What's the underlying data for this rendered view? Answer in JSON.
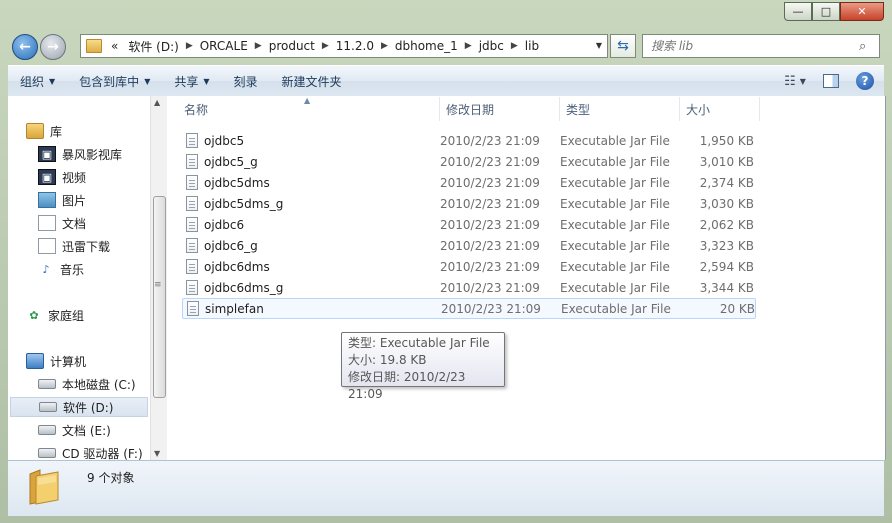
{
  "window": {
    "caption": {
      "minimize": "—",
      "maximize": "□",
      "close": "✕"
    }
  },
  "address": {
    "prefix": "«",
    "crumbs": [
      "软件 (D:)",
      "ORCALE",
      "product",
      "11.2.0",
      "dbhome_1",
      "jdbc",
      "lib"
    ]
  },
  "search": {
    "placeholder": "搜索 lib"
  },
  "toolbar": {
    "organize": "组织",
    "include_in_library": "包含到库中",
    "share": "共享",
    "burn": "刻录",
    "new_folder": "新建文件夹",
    "help": "?"
  },
  "nav_pane": {
    "items": [
      {
        "label": "库",
        "icon": "library-icon"
      },
      {
        "label": "暴风影视库",
        "icon": "video-library-icon"
      },
      {
        "label": "视频",
        "icon": "video-icon"
      },
      {
        "label": "图片",
        "icon": "pictures-icon"
      },
      {
        "label": "文档",
        "icon": "documents-icon"
      },
      {
        "label": "迅雷下载",
        "icon": "documents-icon"
      },
      {
        "label": "音乐",
        "icon": "music-icon"
      },
      {
        "label": "家庭组",
        "icon": "homegroup-icon"
      },
      {
        "label": "计算机",
        "icon": "computer-icon"
      },
      {
        "label": "本地磁盘 (C:)",
        "icon": "drive-icon"
      },
      {
        "label": "软件 (D:)",
        "icon": "drive-icon"
      },
      {
        "label": "文档 (E:)",
        "icon": "drive-icon"
      },
      {
        "label": "CD 驱动器 (F:)",
        "icon": "cd-drive-icon"
      }
    ]
  },
  "columns": {
    "name": "名称",
    "modified": "修改日期",
    "type": "类型",
    "size": "大小"
  },
  "files": [
    {
      "name": "ojdbc5",
      "modified": "2010/2/23 21:09",
      "type": "Executable Jar File",
      "size": "1,950 KB"
    },
    {
      "name": "ojdbc5_g",
      "modified": "2010/2/23 21:09",
      "type": "Executable Jar File",
      "size": "3,010 KB"
    },
    {
      "name": "ojdbc5dms",
      "modified": "2010/2/23 21:09",
      "type": "Executable Jar File",
      "size": "2,374 KB"
    },
    {
      "name": "ojdbc5dms_g",
      "modified": "2010/2/23 21:09",
      "type": "Executable Jar File",
      "size": "3,030 KB"
    },
    {
      "name": "ojdbc6",
      "modified": "2010/2/23 21:09",
      "type": "Executable Jar File",
      "size": "2,062 KB"
    },
    {
      "name": "ojdbc6_g",
      "modified": "2010/2/23 21:09",
      "type": "Executable Jar File",
      "size": "3,323 KB"
    },
    {
      "name": "ojdbc6dms",
      "modified": "2010/2/23 21:09",
      "type": "Executable Jar File",
      "size": "2,594 KB"
    },
    {
      "name": "ojdbc6dms_g",
      "modified": "2010/2/23 21:09",
      "type": "Executable Jar File",
      "size": "3,344 KB"
    },
    {
      "name": "simplefan",
      "modified": "2010/2/23 21:09",
      "type": "Executable Jar File",
      "size": "20 KB"
    }
  ],
  "tooltip": {
    "type": "类型: Executable Jar File",
    "size": "大小: 19.8 KB",
    "modified": "修改日期: 2010/2/23 21:09"
  },
  "details": {
    "count": "9 个对象"
  }
}
